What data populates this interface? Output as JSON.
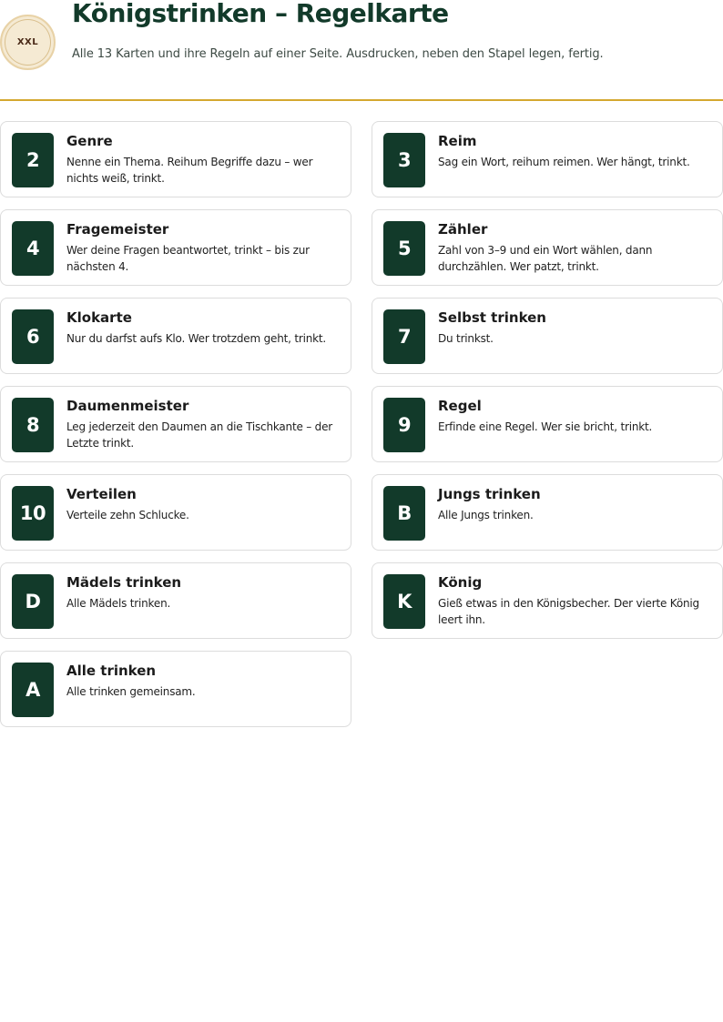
{
  "header": {
    "logo_text": "XXL",
    "title": "Königstrinken – Regelkarte",
    "subtitle": "Alle 13 Karten und ihre Regeln auf einer Seite. Ausdrucken, neben den Stapel legen, fertig."
  },
  "cards": [
    {
      "rank": "2",
      "title": "Genre",
      "text": "Nenne ein Thema. Reihum Begriffe dazu – wer nichts weiß, trinkt."
    },
    {
      "rank": "3",
      "title": "Reim",
      "text": "Sag ein Wort, reihum reimen. Wer hängt, trinkt."
    },
    {
      "rank": "4",
      "title": "Fragemeister",
      "text": "Wer deine Fragen beantwortet, trinkt – bis zur nächsten 4."
    },
    {
      "rank": "5",
      "title": "Zähler",
      "text": "Zahl von 3–9 und ein Wort wählen, dann durchzählen. Wer patzt, trinkt."
    },
    {
      "rank": "6",
      "title": "Klokarte",
      "text": "Nur du darfst aufs Klo. Wer trotzdem geht, trinkt."
    },
    {
      "rank": "7",
      "title": "Selbst trinken",
      "text": "Du trinkst."
    },
    {
      "rank": "8",
      "title": "Daumenmeister",
      "text": "Leg jederzeit den Daumen an die Tischkante – der Letzte trinkt."
    },
    {
      "rank": "9",
      "title": "Regel",
      "text": "Erfinde eine Regel. Wer sie bricht, trinkt."
    },
    {
      "rank": "10",
      "title": "Verteilen",
      "text": "Verteile zehn Schlucke."
    },
    {
      "rank": "B",
      "title": "Jungs trinken",
      "text": "Alle Jungs trinken."
    },
    {
      "rank": "D",
      "title": "Mädels trinken",
      "text": "Alle Mädels trinken."
    },
    {
      "rank": "K",
      "title": "König",
      "text": "Gieß etwas in den Königsbecher. Der vierte König leert ihn."
    },
    {
      "rank": "A",
      "title": "Alle trinken",
      "text": "Alle trinken gemeinsam."
    }
  ]
}
